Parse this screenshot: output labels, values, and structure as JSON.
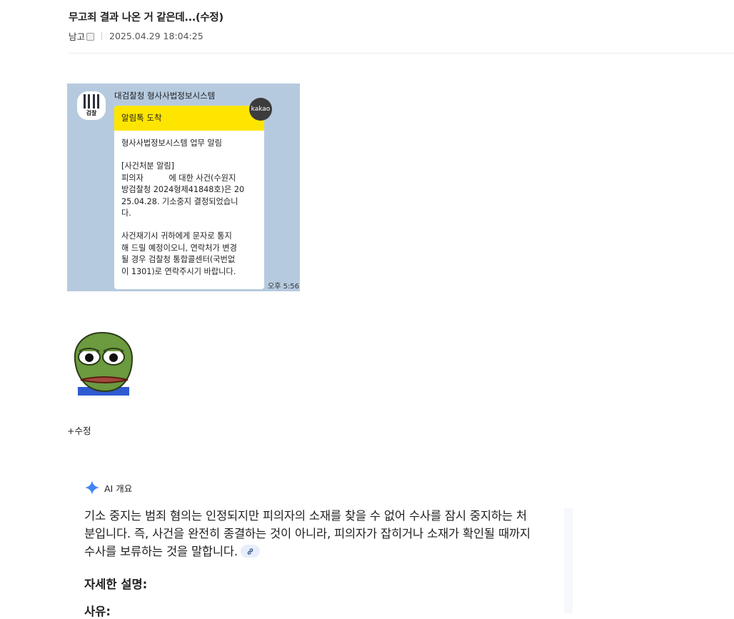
{
  "post": {
    "title": "무고죄 결과 나온 거 같은데...(수정)",
    "author": "남고",
    "timestamp": "2025.04.29 18:04:25"
  },
  "kakao_screenshot": {
    "sender": "대검찰청 형사사법정보시스템",
    "profile_label": "검찰",
    "header": "알림톡 도착",
    "kakao_badge": "kakao",
    "body_lines_1": [
      "형사사법정보시스템 업무 알림"
    ],
    "body_lines_2": [
      "[사건처분 알림]",
      "피의자          에 대한 사건(수원지",
      "방검찰청 2024형제41848호)은 20",
      "25.04.28. 기소중지 결정되었습니",
      "다."
    ],
    "body_lines_3": [
      "사건재기시 귀하에게 문자로 통지",
      "해 드릴 예정이오니, 연락처가 변경",
      "될 경우 검찰청 통합콜센터(국번없",
      "이 1301)로 연락주시기 바랍니다."
    ],
    "time": "오후 5:56"
  },
  "edit_note": "+수정",
  "ai_overview": {
    "label": "AI 개요",
    "summary": "기소 중지는 범죄 혐의는 인정되지만 피의자의 소재를 찾을 수 없어 수사를 잠시 중지하는 처분입니다. 즉, 사건을 완전히 종결하는 것이 아니라, 피의자가 잡히거나 소재가 확인될 때까지 수사를 보류하는 것을 말합니다.",
    "detail_heading": "자세한 설명:",
    "reason_heading": "사유:"
  },
  "colors": {
    "kakao_bg": "#b6cadf",
    "kakao_yellow": "#fee500",
    "ai_star_blue": "#4285f4"
  },
  "icons": [
    "lock-badge-icon",
    "prosecution-logo-icon",
    "kakao-icon",
    "sparkle-icon",
    "link-icon"
  ]
}
